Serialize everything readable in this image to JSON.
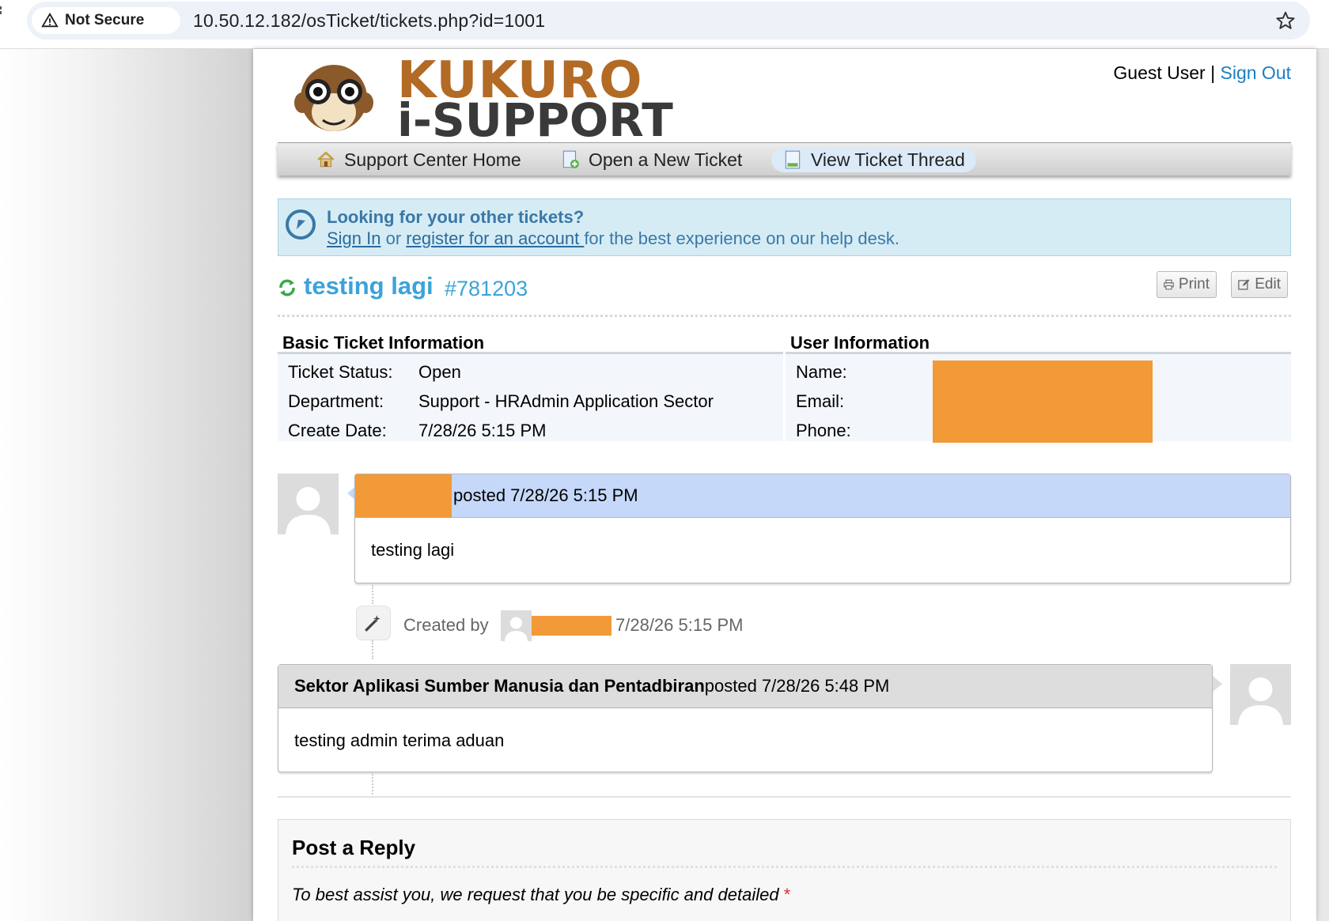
{
  "browser": {
    "security_label": "Not Secure",
    "url": "10.50.12.182/osTicket/tickets.php?id=1001"
  },
  "header": {
    "logo_line1": "KUKURO",
    "logo_line2": "i-SUPPORT",
    "user_label": "Guest User",
    "separator": " | ",
    "sign_out": "Sign Out"
  },
  "nav": {
    "items": [
      {
        "label": "Support Center Home",
        "icon": "home-icon"
      },
      {
        "label": "Open a New Ticket",
        "icon": "new-ticket-icon"
      },
      {
        "label": "View Ticket Thread",
        "icon": "ticket-thread-icon",
        "active": true
      }
    ]
  },
  "banner": {
    "title": "Looking for your other tickets?",
    "sign_in": "Sign In",
    "or_text": " or ",
    "register": "register for an account ",
    "tail": "for the best experience on our help desk."
  },
  "ticket": {
    "subject": "testing lagi",
    "number": "#781203",
    "print_label": "Print",
    "edit_label": "Edit"
  },
  "basic_info": {
    "heading": "Basic Ticket Information",
    "rows": [
      {
        "label": "Ticket Status:",
        "value": "Open"
      },
      {
        "label": "Department:",
        "value": "Support - HRAdmin Application Sector"
      },
      {
        "label": "Create Date:",
        "value": "7/28/26 5:15 PM"
      }
    ]
  },
  "user_info": {
    "heading": "User Information",
    "rows": [
      {
        "label": "Name:"
      },
      {
        "label": "Email:"
      },
      {
        "label": "Phone:"
      }
    ]
  },
  "thread": {
    "message1": {
      "posted": "posted 7/28/26 5:15 PM",
      "body": "testing lagi"
    },
    "event": {
      "created_by": "Created by",
      "time": "7/28/26 5:15 PM"
    },
    "response1": {
      "author": "Sektor Aplikasi Sumber Manusia dan Pentadbiran",
      "posted": " posted 7/28/26 5:48 PM",
      "body": "testing admin terima aduan"
    }
  },
  "reply": {
    "title": "Post a Reply",
    "hint": "To best assist you, we request that you be specific and detailed",
    "required_mark": "*"
  },
  "colors": {
    "link": "#1a7fc1",
    "ticket_title": "#3aa3d9",
    "redaction": "#f29a38",
    "message_header": "#c6d8fa",
    "response_header": "#dddddd"
  }
}
